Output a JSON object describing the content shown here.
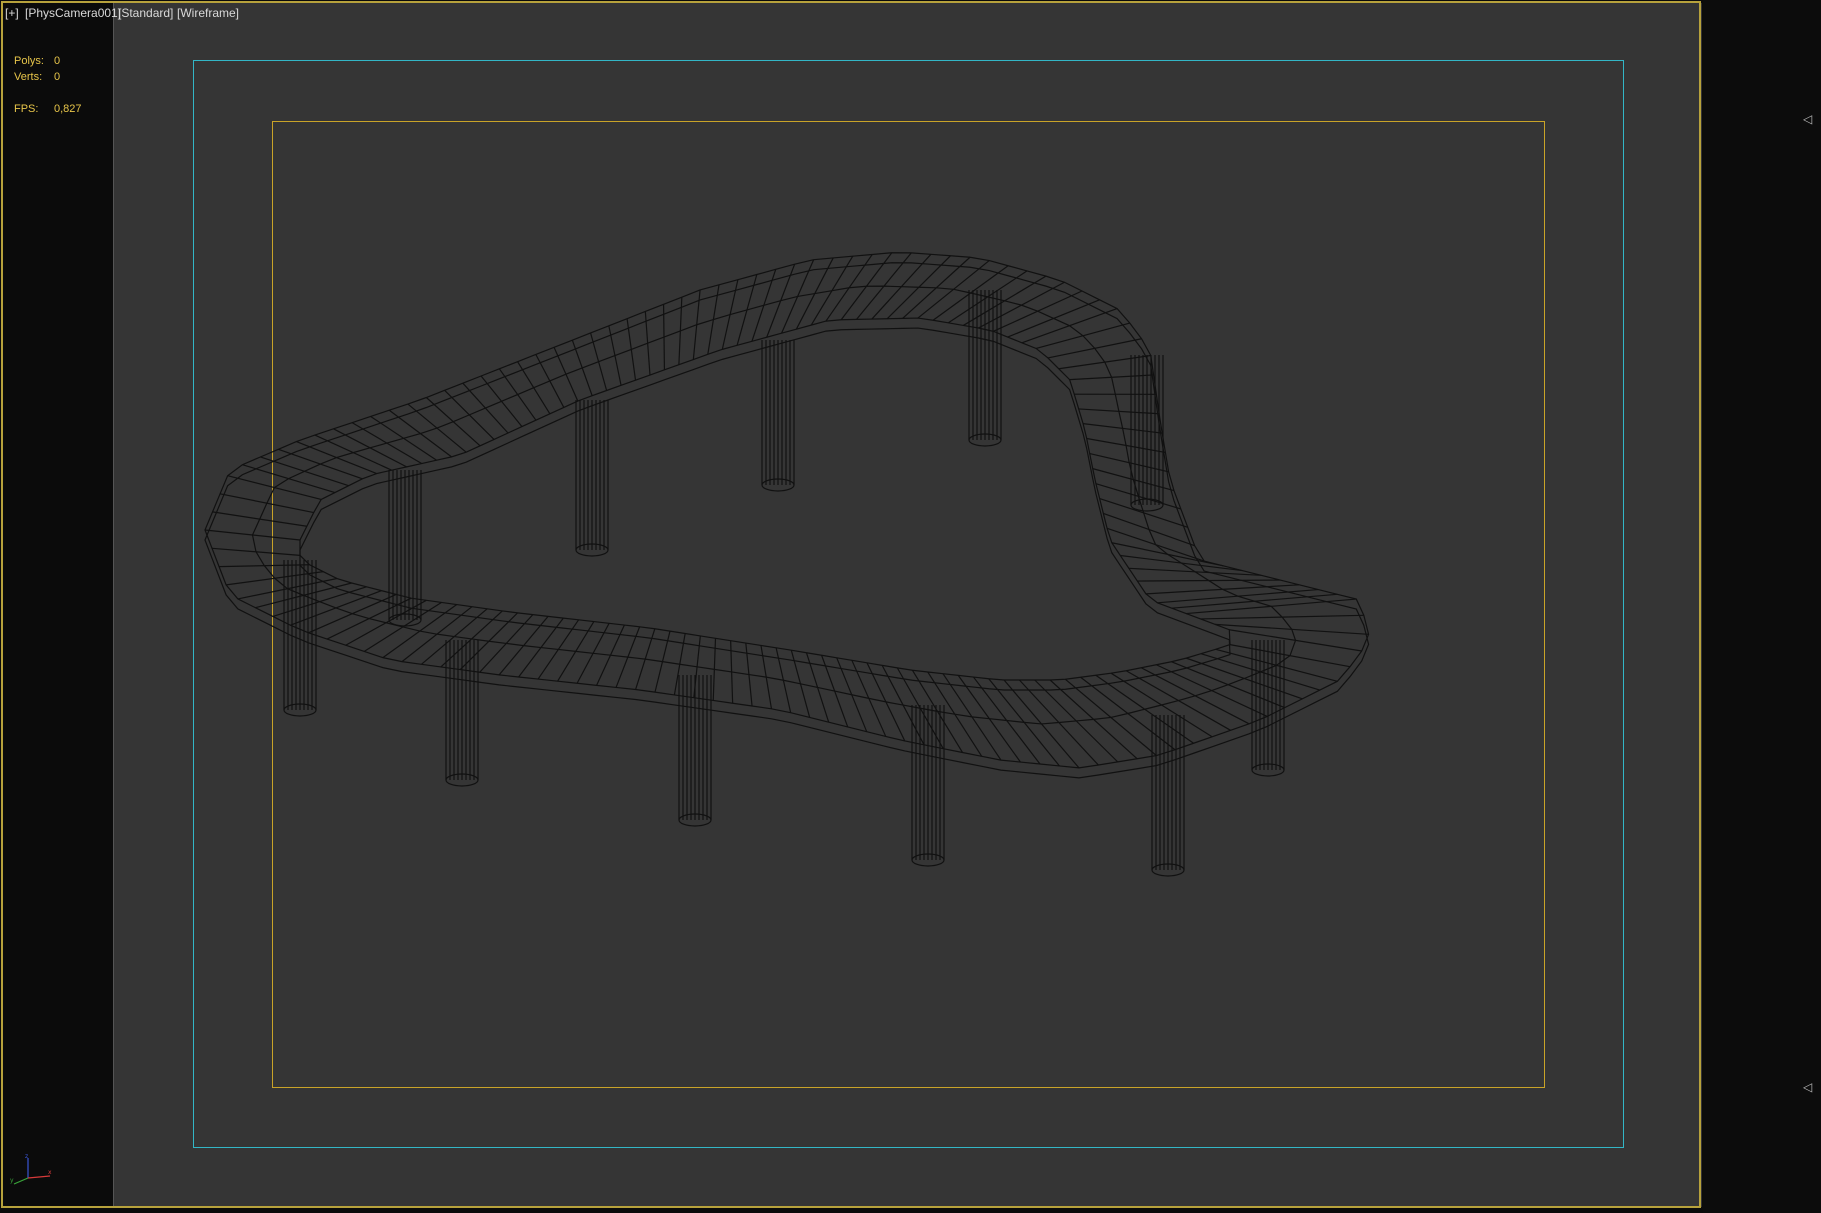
{
  "viewport": {
    "menu_label": "[+]",
    "camera_label": "[PhysCamera001]",
    "shading_label": "[Standard]",
    "mode_label": "[Wireframe]"
  },
  "stats": {
    "polys_label": "Polys:",
    "polys_value": "0",
    "verts_label": "Verts:",
    "verts_value": "0",
    "fps_label": "FPS:",
    "fps_value": "0,827"
  },
  "colors": {
    "viewport_bg": "#353535",
    "border_active": "#b7a23c",
    "safe_frame_outer": "#33b6c6",
    "safe_frame_inner": "#c9a328",
    "wire": "#111111",
    "stats_text": "#e8c64a"
  },
  "icons": {
    "axis_gizmo": "xyz-axis-icon",
    "marker": "triangle-left-icon"
  }
}
